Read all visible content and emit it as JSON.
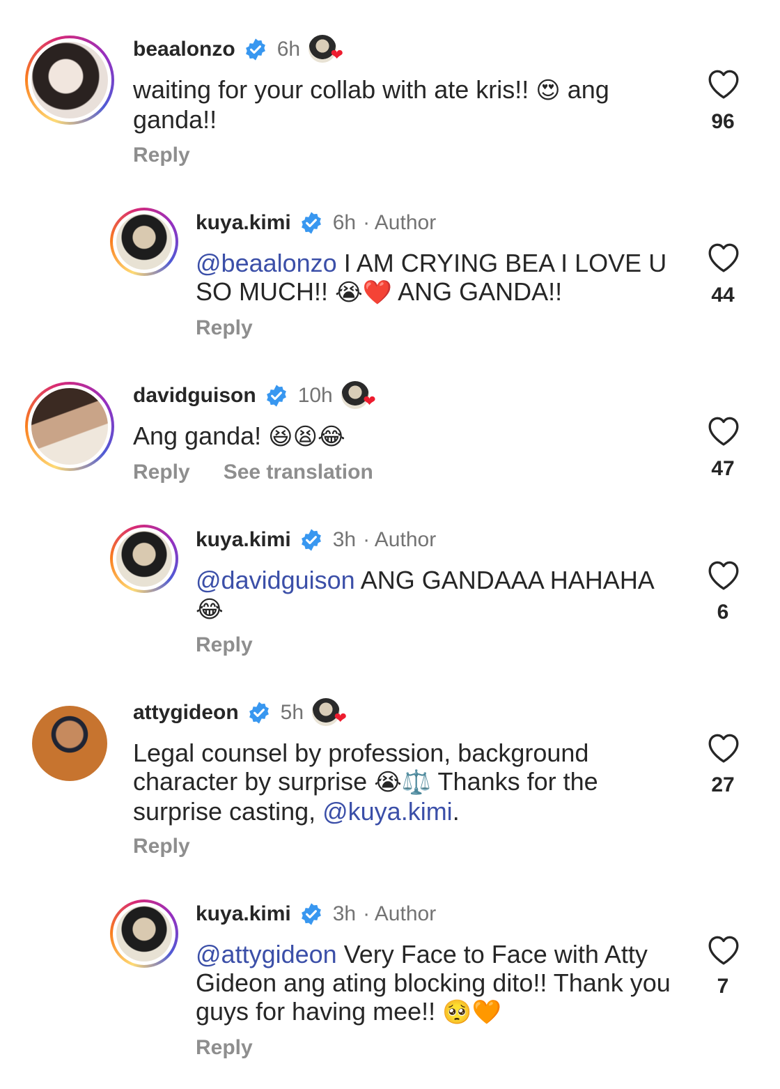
{
  "comments": [
    {
      "kind": "top",
      "username": "beaalonzo",
      "time": "6h",
      "author_tag": "",
      "text_parts": [
        {
          "t": "waiting for your collab with ate kris!! "
        },
        {
          "t": "😍",
          "emoji": true
        },
        {
          "t": " ang ganda!!"
        }
      ],
      "reply_label": "Reply",
      "see_translation": "",
      "likes": "96",
      "liked_by_creator": true
    },
    {
      "kind": "reply",
      "username": "kuya.kimi",
      "time": "6h",
      "author_tag": "· Author",
      "text_parts": [
        {
          "t": "@beaalonzo",
          "mention": true
        },
        {
          "t": " I AM CRYING BEA I LOVE U SO MUCH!! "
        },
        {
          "t": "😭❤️",
          "emoji": true
        },
        {
          "t": " ANG GANDA!!"
        }
      ],
      "reply_label": "Reply",
      "see_translation": "",
      "likes": "44",
      "liked_by_creator": false
    },
    {
      "kind": "top",
      "username": "davidguison",
      "time": "10h",
      "author_tag": "",
      "text_parts": [
        {
          "t": "Ang ganda! "
        },
        {
          "t": "😆😫😂",
          "emoji": true
        }
      ],
      "reply_label": "Reply",
      "see_translation": "See translation",
      "likes": "47",
      "liked_by_creator": true
    },
    {
      "kind": "reply",
      "username": "kuya.kimi",
      "time": "3h",
      "author_tag": "· Author",
      "text_parts": [
        {
          "t": "@davidguison",
          "mention": true
        },
        {
          "t": " ANG GANDAAA HAHAHA "
        },
        {
          "t": "😂",
          "emoji": true
        }
      ],
      "reply_label": "Reply",
      "see_translation": "",
      "likes": "6",
      "liked_by_creator": false
    },
    {
      "kind": "top",
      "username": "attygideon",
      "time": "5h",
      "author_tag": "",
      "text_parts": [
        {
          "t": "Legal counsel by profession, background character by surprise "
        },
        {
          "t": "😭⚖️",
          "emoji": true
        },
        {
          "t": " Thanks for the surprise casting, "
        },
        {
          "t": "@kuya.kimi",
          "mention": true
        },
        {
          "t": "."
        }
      ],
      "reply_label": "Reply",
      "see_translation": "",
      "likes": "27",
      "liked_by_creator": true
    },
    {
      "kind": "reply",
      "username": "kuya.kimi",
      "time": "3h",
      "author_tag": "· Author",
      "text_parts": [
        {
          "t": "@attygideon",
          "mention": true
        },
        {
          "t": " Very Face to Face with Atty Gideon ang ating blocking dito!! Thank you guys for having mee!! "
        },
        {
          "t": "🥺🧡",
          "emoji": true
        }
      ],
      "reply_label": "Reply",
      "see_translation": "",
      "likes": "7",
      "liked_by_creator": false
    }
  ],
  "colors": {
    "mention": "#3b4fa8",
    "verified": "#3897f0",
    "muted": "#737373",
    "creator_heart": "#ed1c2e"
  },
  "icons": {
    "verified": "verified-badge-icon",
    "like": "heart-outline-icon"
  }
}
